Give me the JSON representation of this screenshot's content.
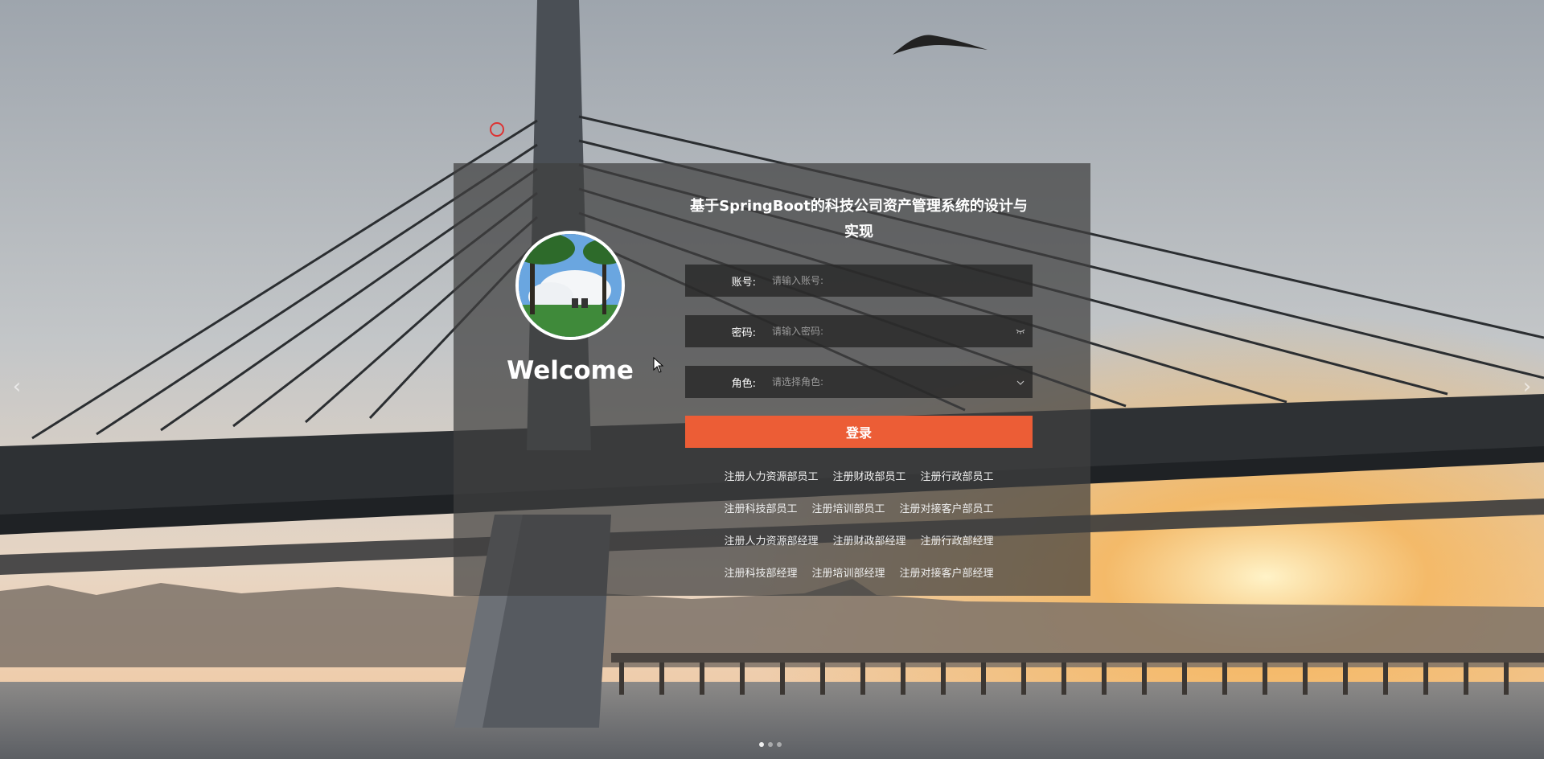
{
  "background": {
    "sky": "#aeb4bb",
    "sunset": "#f3a24b",
    "water": "#6d6f73"
  },
  "login": {
    "title": "基于SpringBoot的科技公司资产管理系统的设计与实现",
    "welcome": "Welcome",
    "fields": {
      "account": {
        "label": "账号:",
        "placeholder": "请输入账号:"
      },
      "password": {
        "label": "密码:",
        "placeholder": "请输入密码:",
        "toggle_icon": "eye-closed-icon"
      },
      "role": {
        "label": "角色:",
        "placeholder": "请选择角色:",
        "dropdown_icon": "chevron-down-icon"
      }
    },
    "login_button": "登录",
    "accent": "#ec5d36",
    "register_links": [
      [
        "注册人力资源部员工",
        "注册财政部员工",
        "注册行政部员工"
      ],
      [
        "注册科技部员工",
        "注册培训部员工",
        "注册对接客户部员工"
      ],
      [
        "注册人力资源部经理",
        "注册财政部经理",
        "注册行政部经理"
      ],
      [
        "注册科技部经理",
        "注册培训部经理",
        "注册对接客户部经理"
      ]
    ]
  },
  "carousel": {
    "prev_icon": "chevron-left-icon",
    "next_icon": "chevron-right-icon",
    "slide_count": 3,
    "active_index": 0
  }
}
